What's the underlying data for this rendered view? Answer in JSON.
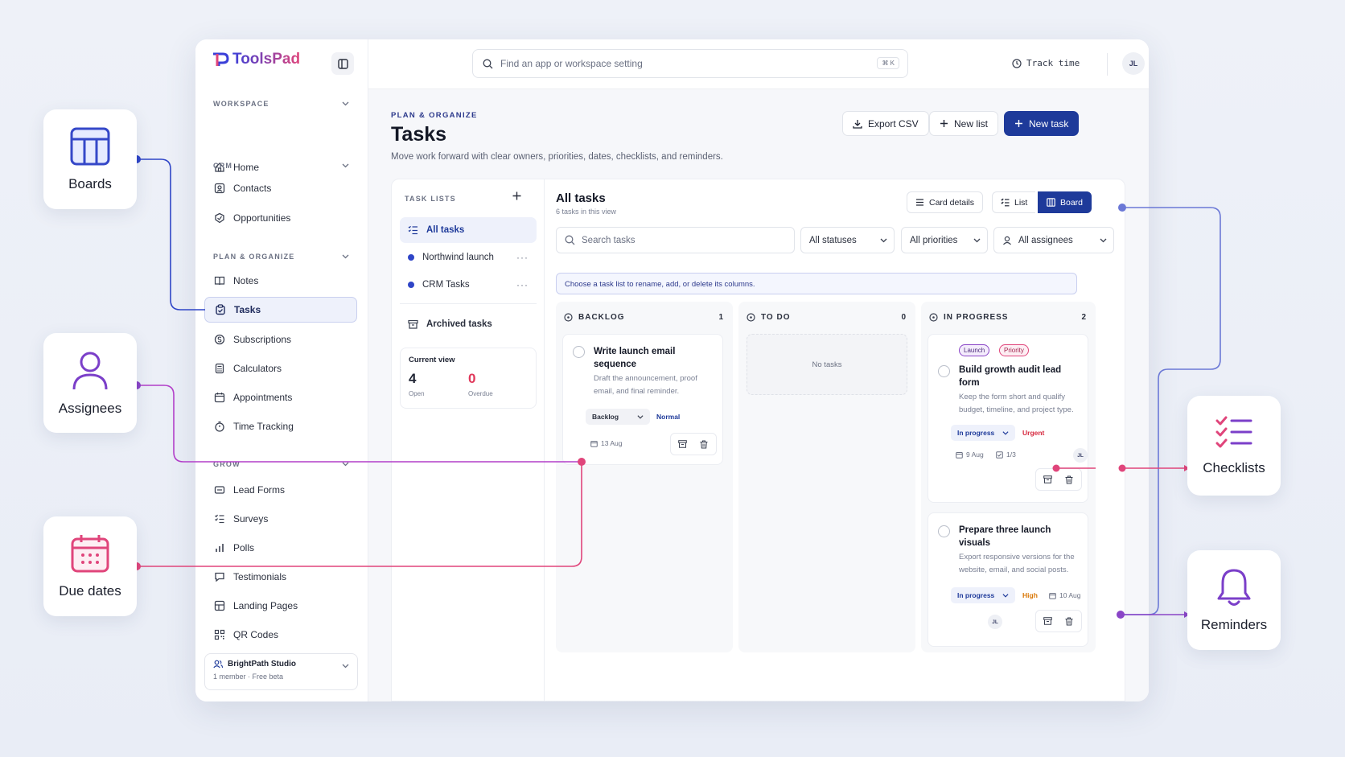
{
  "features": {
    "boards": "Boards",
    "assignees": "Assignees",
    "due_dates": "Due dates",
    "checklists": "Checklists",
    "reminders": "Reminders"
  },
  "colors": {
    "brand": "#1e3a9a",
    "accent_pink": "#e0457b",
    "accent_purple": "#8a45c7",
    "overdue": "#e0385a",
    "urgent": "#d6293f",
    "high": "#d97706"
  },
  "app": {
    "logo": "ToolsPad",
    "search": {
      "placeholder": "Find an app or workspace setting",
      "shortcut": "⌘ K"
    },
    "track_time": "Track time",
    "user_initials": "JL"
  },
  "sidebar": {
    "sections": [
      {
        "title": "WORKSPACE",
        "items": [
          {
            "label": "Home",
            "icon": "home-icon"
          }
        ]
      },
      {
        "title": "CRM",
        "items": [
          {
            "label": "Contacts",
            "icon": "contacts-icon"
          },
          {
            "label": "Opportunities",
            "icon": "opportunities-icon"
          }
        ]
      },
      {
        "title": "PLAN & ORGANIZE",
        "items": [
          {
            "label": "Notes",
            "icon": "notes-icon"
          },
          {
            "label": "Tasks",
            "icon": "tasks-icon"
          },
          {
            "label": "Subscriptions",
            "icon": "subscriptions-icon"
          },
          {
            "label": "Calculators",
            "icon": "calculator-icon"
          },
          {
            "label": "Appointments",
            "icon": "calendar-icon"
          },
          {
            "label": "Time Tracking",
            "icon": "stopwatch-icon"
          }
        ]
      },
      {
        "title": "GROW",
        "items": [
          {
            "label": "Lead Forms",
            "icon": "form-icon"
          },
          {
            "label": "Surveys",
            "icon": "survey-icon"
          },
          {
            "label": "Polls",
            "icon": "poll-icon"
          },
          {
            "label": "Testimonials",
            "icon": "testimonial-icon"
          },
          {
            "label": "Landing Pages",
            "icon": "landing-page-icon"
          },
          {
            "label": "QR Codes",
            "icon": "qr-code-icon"
          }
        ]
      }
    ],
    "active": "Tasks",
    "workspace": {
      "name": "BrightPath Studio",
      "sub": "1 member · Free beta"
    }
  },
  "page": {
    "eyebrow": "PLAN & ORGANIZE",
    "title": "Tasks",
    "description": "Move work forward with clear owners, priorities, dates, checklists, and reminders.",
    "actions": {
      "export": "Export CSV",
      "new_list": "New list",
      "new_task": "New task"
    }
  },
  "task_lists": {
    "heading": "TASK LISTS",
    "items": [
      {
        "label": "All tasks"
      },
      {
        "label": "Northwind launch"
      },
      {
        "label": "CRM Tasks"
      }
    ],
    "archived": "Archived tasks",
    "current_view": {
      "title": "Current view",
      "open": "4",
      "open_label": "Open",
      "overdue": "0",
      "overdue_label": "Overdue"
    }
  },
  "board": {
    "title": "All tasks",
    "subtitle": "6 tasks in this view",
    "card_details": "Card details",
    "view_list": "List",
    "view_board": "Board",
    "search_placeholder": "Search tasks",
    "filters": {
      "status": "All statuses",
      "priority": "All priorities",
      "assignee": "All assignees"
    },
    "banner": "Choose a task list to rename, add, or delete its columns.",
    "columns": [
      {
        "name": "BACKLOG",
        "count": "1"
      },
      {
        "name": "TO DO",
        "count": "0",
        "empty": "No tasks"
      },
      {
        "name": "IN PROGRESS",
        "count": "2"
      }
    ],
    "tasks": {
      "t1": {
        "title": "Write launch email sequence",
        "desc": "Draft the announcement, proof email, and final reminder.",
        "status": "Backlog",
        "priority": "Normal",
        "date": "13 Aug"
      },
      "t2": {
        "tags": [
          "Launch",
          "Priority"
        ],
        "title": "Build growth audit lead form",
        "desc": "Keep the form short and qualify budget, timeline, and project type.",
        "status": "In progress",
        "priority": "Urgent",
        "date": "9 Aug",
        "checklist": "1/3",
        "assignee": "JL"
      },
      "t3": {
        "title": "Prepare three launch visuals",
        "desc": "Export responsive versions for the website, email, and social posts.",
        "status": "In progress",
        "priority": "High",
        "date": "10 Aug",
        "assignee": "JL"
      }
    }
  }
}
